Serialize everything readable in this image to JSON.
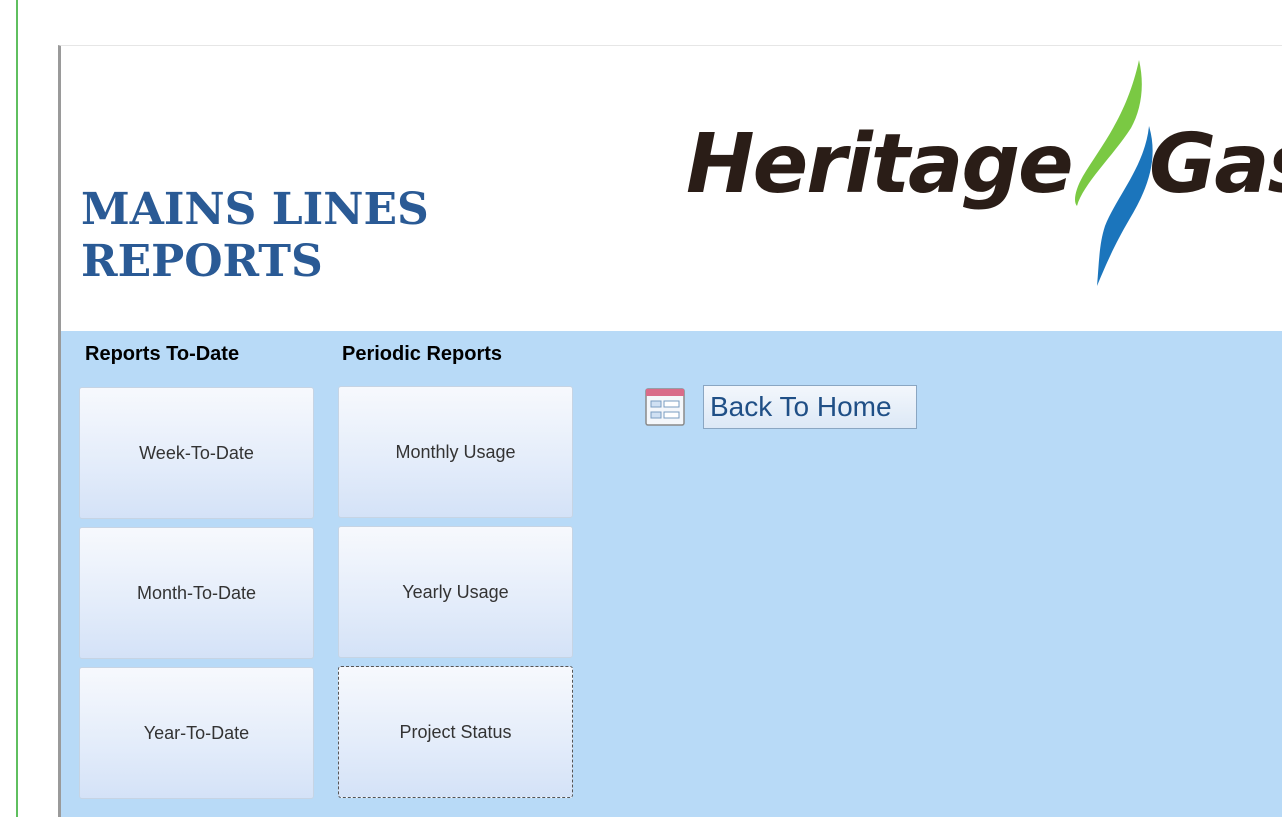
{
  "header": {
    "title_line1": "MAINS LINES",
    "title_line2": "REPORTS",
    "logo": {
      "word1": "Heritage",
      "word2": "Gas",
      "colors": {
        "text": "#2a1d17",
        "green": "#7ac943",
        "blue": "#1b75bc"
      }
    }
  },
  "reports_to_date": {
    "label": "Reports To-Date",
    "buttons": [
      "Week-To-Date",
      "Month-To-Date",
      "Year-To-Date"
    ]
  },
  "periodic_reports": {
    "label": "Periodic Reports",
    "buttons": [
      "Monthly Usage",
      "Yearly Usage",
      "Project Status"
    ],
    "focused_button": "Project Status"
  },
  "back_to_home": {
    "label": "Back To Home",
    "icon": "form-icon"
  },
  "colors": {
    "title": "#2a5a95",
    "detail_background": "#b8daf7",
    "button_text": "#333333",
    "link_text": "#1f4f86"
  }
}
